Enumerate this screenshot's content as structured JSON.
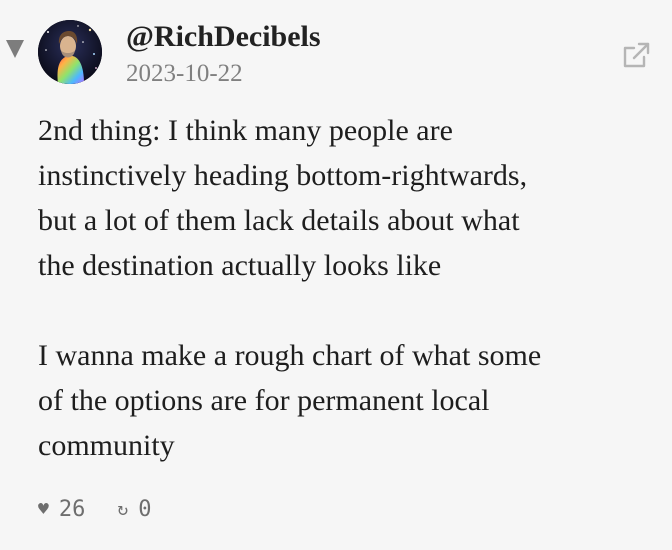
{
  "post": {
    "handle": "@RichDecibels",
    "date": "2023-10-22",
    "paragraphs": [
      "2nd thing: I think many people are\ninstinctively heading bottom-rightwards,\nbut a lot of them lack details about what\nthe destination actually looks like",
      "I wanna make a rough chart of what some\nof the options are for permanent local\ncommunity"
    ],
    "likes": "26",
    "reposts": "0"
  },
  "icons": {
    "collapse": "triangle-down-icon",
    "external": "external-link-icon",
    "like": "heart-icon",
    "repost": "repost-icon",
    "like_glyph": "♥",
    "repost_glyph": "↻"
  },
  "colors": {
    "background": "#f6f6f6",
    "text": "#1e1e1e",
    "muted": "#808080",
    "icon": "#b5b5b5"
  }
}
